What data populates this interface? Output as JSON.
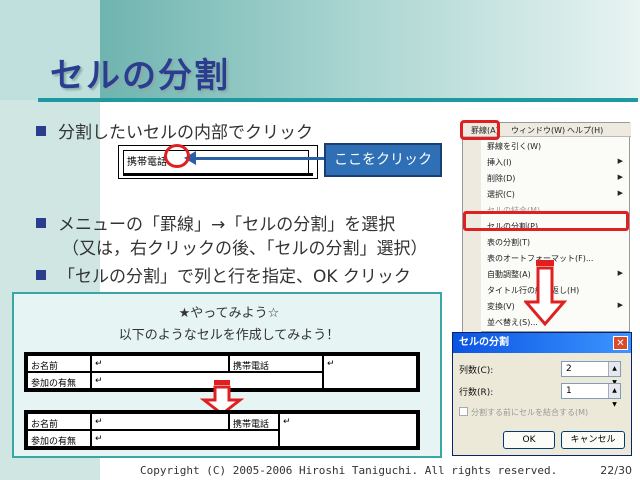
{
  "slide": {
    "title": "セルの分割",
    "bullets": [
      "分割したいセルの内部でクリック",
      "メニューの「罫線」→「セルの分割」を選択",
      "「セルの分割」で列と行を指定、OK クリック"
    ],
    "sub_bullet": "（又は，右クリックの後、「セルの分割」選択）",
    "demo_cell_label": "携帯電話",
    "callout": "ここをクリック",
    "footer_copyright": "Copyright (C) 2005-2006 Hiroshi Taniguchi. All rights reserved.",
    "page_number": "22/30"
  },
  "menu": {
    "menubar": [
      "罫線(A)",
      "ウィンドウ(W)",
      "ヘルプ(H)"
    ],
    "items": [
      {
        "label": "罫線を引く(W)",
        "disabled": false,
        "submenu": false
      },
      {
        "label": "挿入(I)",
        "disabled": false,
        "submenu": true
      },
      {
        "label": "削除(D)",
        "disabled": false,
        "submenu": true
      },
      {
        "label": "選択(C)",
        "disabled": false,
        "submenu": true
      },
      {
        "label": "セルの結合(M)",
        "disabled": true,
        "submenu": false
      },
      {
        "label": "セルの分割(P)...",
        "disabled": false,
        "submenu": false
      },
      {
        "label": "表の分割(T)",
        "disabled": false,
        "submenu": false
      },
      {
        "label": "表のオートフォーマット(F)...",
        "disabled": false,
        "submenu": false
      },
      {
        "label": "自動調整(A)",
        "disabled": false,
        "submenu": true
      },
      {
        "label": "タイトル行の繰り返し(H)",
        "disabled": false,
        "submenu": false
      },
      {
        "label": "変換(V)",
        "disabled": false,
        "submenu": true
      },
      {
        "label": "並べ替え(S)...",
        "disabled": false,
        "submenu": false
      }
    ]
  },
  "tryout": {
    "heading": "★やってみよう☆",
    "instruction": "以下のようなセルを作成してみよう！",
    "table1": {
      "name": "お名前",
      "mobile": "携帯電話",
      "attend": "参加の有無",
      "mark": "↵"
    },
    "table2": {
      "name": "お名前",
      "mobile": "携帯電話",
      "attend": "参加の有無",
      "mark": "↵"
    }
  },
  "dialog": {
    "title": "セルの分割",
    "cols_label": "列数(C):",
    "cols_value": "2",
    "rows_label": "行数(R):",
    "rows_value": "1",
    "merge_label": "分割する前にセルを結合する(M)",
    "ok": "OK",
    "cancel": "キャンセル"
  },
  "colors": {
    "accent": "#2b3d8f",
    "highlight": "#e02020",
    "teal": "#3aa6a6"
  }
}
